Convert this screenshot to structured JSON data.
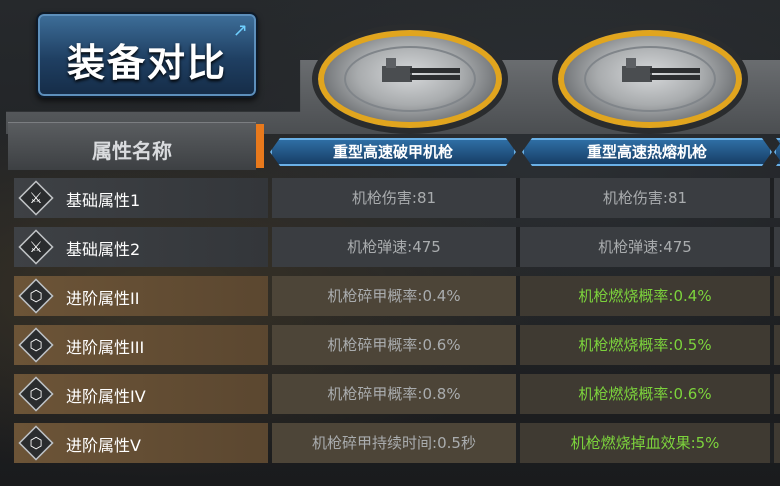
{
  "title": "装备对比",
  "header": {
    "attr_name": "属性名称",
    "columns": [
      "重型高速破甲机枪",
      "重型高速热熔机枪"
    ]
  },
  "rows": [
    {
      "label": "基础属性1",
      "type": "basic",
      "icon": "crossed-swords-icon",
      "values": [
        "机枪伤害:81",
        "机枪伤害:81"
      ],
      "green": false
    },
    {
      "label": "基础属性2",
      "type": "basic",
      "icon": "crossed-swords-icon",
      "values": [
        "机枪弹速:475",
        "机枪弹速:475"
      ],
      "green": false
    },
    {
      "label": "进阶属性II",
      "type": "advanced",
      "icon": "hexagon-icon",
      "values": [
        "机枪碎甲概率:0.4%",
        "机枪燃烧概率:0.4%"
      ],
      "green": true
    },
    {
      "label": "进阶属性III",
      "type": "advanced",
      "icon": "hexagon-icon",
      "values": [
        "机枪碎甲概率:0.6%",
        "机枪燃烧概率:0.5%"
      ],
      "green": true
    },
    {
      "label": "进阶属性IV",
      "type": "advanced",
      "icon": "hexagon-icon",
      "values": [
        "机枪碎甲概率:0.8%",
        "机枪燃烧概率:0.6%"
      ],
      "green": true
    },
    {
      "label": "进阶属性V",
      "type": "advanced",
      "icon": "hexagon-icon",
      "values": [
        "机枪碎甲持续时间:0.5秒",
        "机枪燃烧掉血效果:5%"
      ],
      "green": true
    }
  ],
  "colors": {
    "accent_orange": "#e8791c",
    "highlight_green": "#7cd33c",
    "header_blue": "#2f6ea4"
  }
}
